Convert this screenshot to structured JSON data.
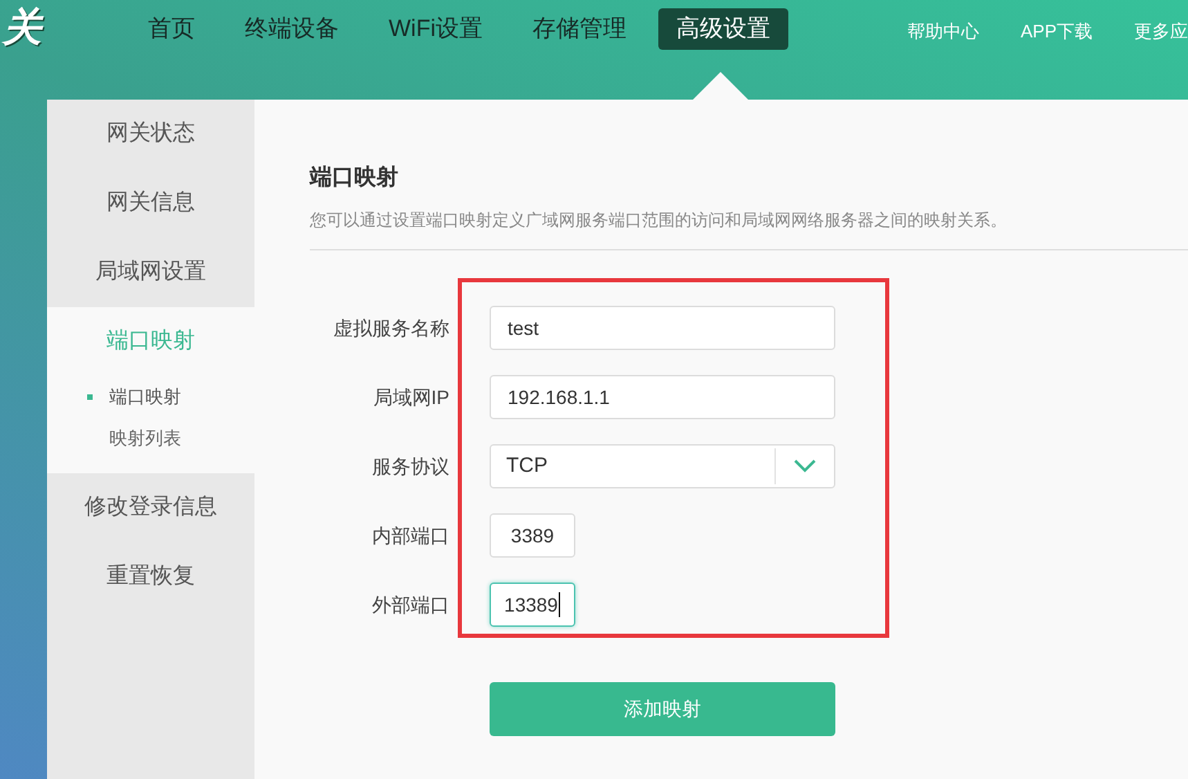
{
  "logo": {
    "text": "关"
  },
  "nav": [
    {
      "label": "首页",
      "selected": false
    },
    {
      "label": "终端设备",
      "selected": false
    },
    {
      "label": "WiFi设置",
      "selected": false
    },
    {
      "label": "存储管理",
      "selected": false
    },
    {
      "label": "高级设置",
      "selected": true
    }
  ],
  "header_links": [
    "帮助中心",
    "APP下载",
    "更多应"
  ],
  "sidebar": {
    "items": [
      {
        "label": "网关状态",
        "selected": false
      },
      {
        "label": "网关信息",
        "selected": false
      },
      {
        "label": "局域网设置",
        "selected": false
      },
      {
        "label": "端口映射",
        "selected": true,
        "children": [
          {
            "label": "端口映射",
            "selected": true
          },
          {
            "label": "映射列表",
            "selected": false
          }
        ]
      },
      {
        "label": "修改登录信息",
        "selected": false
      },
      {
        "label": "重置恢复",
        "selected": false
      }
    ]
  },
  "content": {
    "title": "端口映射",
    "description": "您可以通过设置端口映射定义广域网服务端口范围的访问和局域网网络服务器之间的映射关系。",
    "fields": [
      {
        "kind": "text",
        "label": "虚拟服务名称",
        "value": "test",
        "focused": false
      },
      {
        "kind": "text",
        "label": "局域网IP",
        "value": "192.168.1.1",
        "focused": false
      },
      {
        "kind": "select",
        "label": "服务协议",
        "value": "TCP",
        "focused": false
      },
      {
        "kind": "port",
        "label": "内部端口",
        "value": "3389",
        "focused": false
      },
      {
        "kind": "port",
        "label": "外部端口",
        "value": "13389",
        "focused": true
      }
    ],
    "submit": "添加映射"
  }
}
